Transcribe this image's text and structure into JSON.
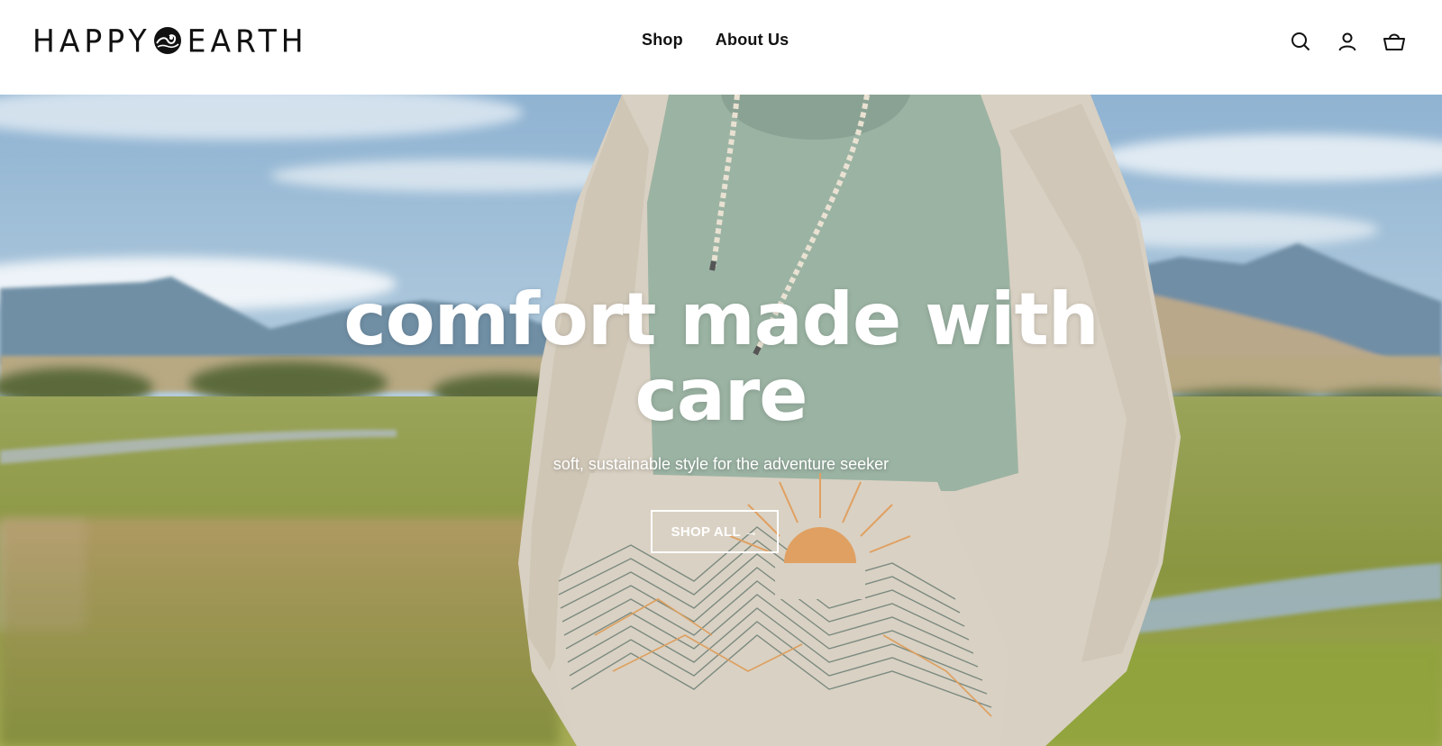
{
  "brand": {
    "name_left": "HAPPY",
    "name_right": "EARTH"
  },
  "nav": {
    "items": [
      {
        "label": "Shop"
      },
      {
        "label": "About Us"
      }
    ]
  },
  "header_icons": [
    "search-icon",
    "account-icon",
    "cart-icon"
  ],
  "hero": {
    "headline": "comfort made with care",
    "subheadline": "soft, sustainable style for the adventure seeker",
    "cta_label": "SHOP ALL →"
  },
  "colors": {
    "text_dark": "#111111",
    "hoodie_green": "#9bb3a3",
    "hoodie_oat": "#d8d0c2",
    "sun_orange": "#e0a062",
    "sky": "#a9c6dc"
  }
}
